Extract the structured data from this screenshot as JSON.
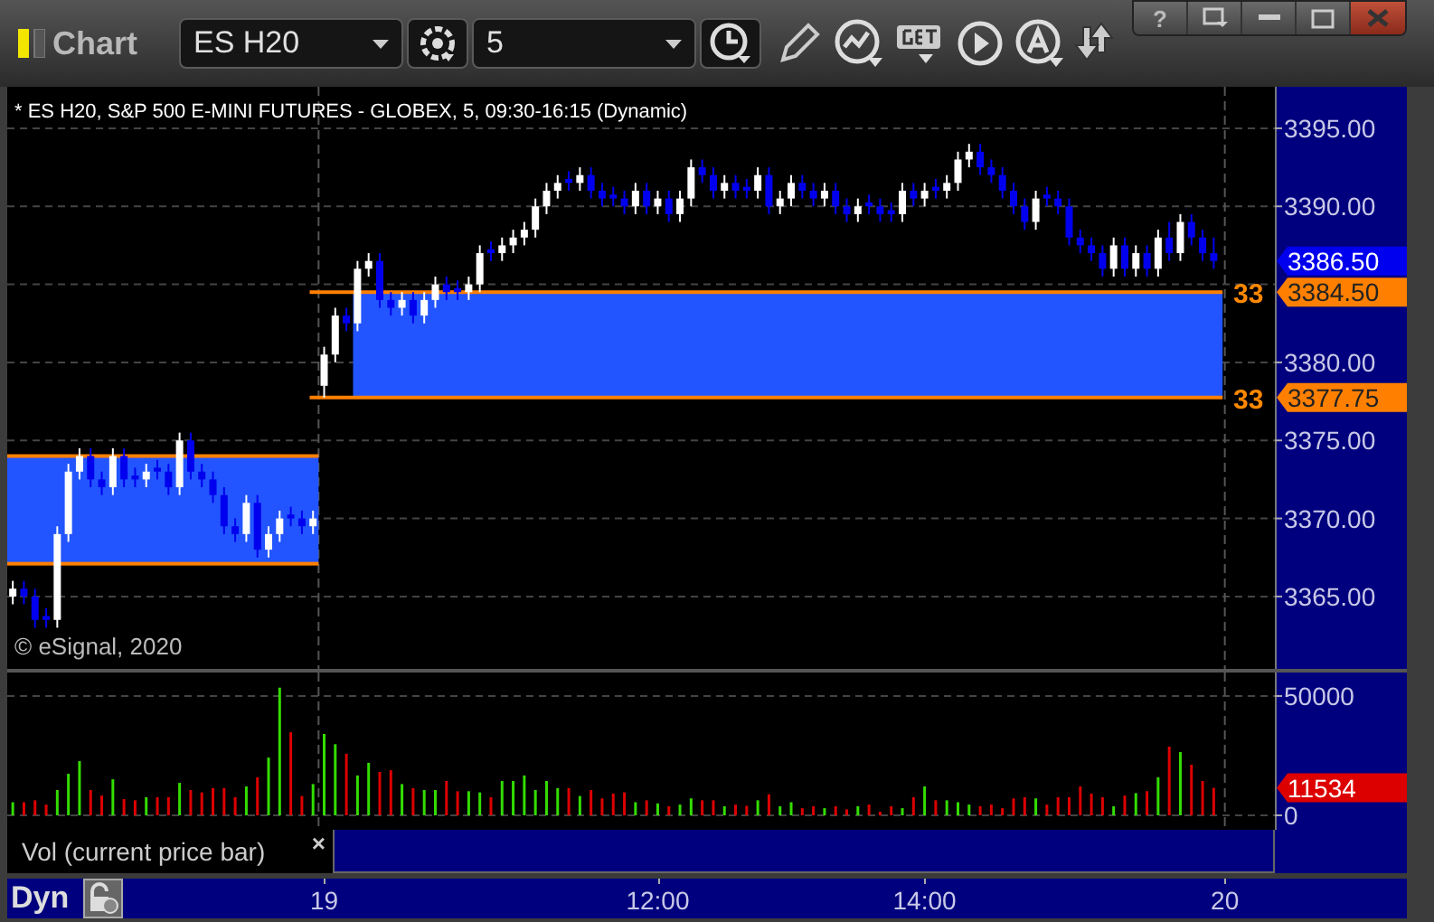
{
  "window": {
    "title": "Chart",
    "help_button": "?"
  },
  "toolbar": {
    "symbol": "ES H20",
    "interval": "5"
  },
  "chart_title": "* ES H20, S&P 500 E-MINI FUTURES - GLOBEX, 5, 09:30-16:15 (Dynamic)",
  "copyright": "© eSignal, 2020",
  "price_chart": {
    "chart_data": {
      "type": "candlestick",
      "grid": true,
      "categories": [
        null,
        null,
        null,
        null,
        null,
        null,
        null,
        null,
        null,
        null,
        null,
        null,
        null,
        null,
        null,
        null,
        null,
        null,
        null,
        null,
        null,
        null,
        null,
        null,
        null,
        null,
        null,
        null,
        null,
        null,
        null,
        null,
        null,
        null,
        null,
        null,
        null,
        null,
        null,
        null,
        null,
        null,
        null,
        null,
        null,
        null,
        null,
        null,
        null,
        null,
        null,
        null,
        null,
        null,
        null,
        null,
        null,
        null,
        null,
        null,
        null,
        null,
        null,
        null,
        null,
        null,
        null,
        null,
        null,
        null,
        null,
        null,
        null,
        null,
        null,
        null,
        null,
        null,
        null,
        null,
        null,
        null,
        null,
        null,
        null,
        null,
        null,
        null,
        null,
        null,
        null,
        null,
        null,
        null,
        null,
        null,
        null,
        null,
        null,
        null,
        null,
        null,
        null,
        null,
        null,
        null,
        null,
        null,
        null,
        null,
        null,
        null,
        null,
        null
      ],
      "ohlc": [
        [
          3365,
          3366,
          3364.5,
          3365.5
        ],
        [
          3365.5,
          3366,
          3364.5,
          3365
        ],
        [
          3365,
          3365.5,
          3363,
          3363.5
        ],
        [
          3363.75,
          3364.25,
          3363,
          3363.5
        ],
        [
          3363.5,
          3369.5,
          3363,
          3369
        ],
        [
          3369,
          3373.5,
          3368.5,
          3373
        ],
        [
          3373,
          3374.5,
          3372.5,
          3374
        ],
        [
          3374,
          3374.5,
          3372,
          3372.5
        ],
        [
          3372.5,
          3373,
          3371.5,
          3372
        ],
        [
          3372,
          3374.5,
          3371.5,
          3374
        ],
        [
          3374,
          3374.5,
          3372,
          3372.5
        ],
        [
          3372.75,
          3373.25,
          3372,
          3372.5
        ],
        [
          3372.5,
          3373.5,
          3372,
          3373
        ],
        [
          3373.25,
          3373.75,
          3372.5,
          3373
        ],
        [
          3373,
          3373.5,
          3371.5,
          3372
        ],
        [
          3372,
          3375.5,
          3371.5,
          3375
        ],
        [
          3375,
          3375.5,
          3372.5,
          3373
        ],
        [
          3373,
          3373.5,
          3372,
          3372.5
        ],
        [
          3372.5,
          3373,
          3371,
          3371.5
        ],
        [
          3371.5,
          3372,
          3369,
          3369.5
        ],
        [
          3369.5,
          3370,
          3368.5,
          3369
        ],
        [
          3369,
          3371.5,
          3368.5,
          3371
        ],
        [
          3371,
          3371.5,
          3367.5,
          3368
        ],
        [
          3368,
          3369.5,
          3367.5,
          3369
        ],
        [
          3369,
          3370.5,
          3368.5,
          3370
        ],
        [
          3370.25,
          3370.75,
          3369.5,
          3370
        ],
        [
          3370,
          3370.5,
          3369,
          3369.5
        ],
        [
          3369.5,
          3370.5,
          3369,
          3370
        ],
        [
          3378.5,
          3381,
          3377.75,
          3380.5
        ],
        [
          3380.5,
          3383.5,
          3380,
          3383
        ],
        [
          3383,
          3383.5,
          3382,
          3382.5
        ],
        [
          3382.5,
          3386.5,
          3382,
          3386
        ],
        [
          3386,
          3387,
          3385.5,
          3386.5
        ],
        [
          3386.5,
          3387,
          3383.5,
          3384
        ],
        [
          3384,
          3384.5,
          3383,
          3383.5
        ],
        [
          3383.5,
          3384.5,
          3383,
          3384
        ],
        [
          3384,
          3384.5,
          3382.5,
          3383
        ],
        [
          3383,
          3384.5,
          3382.5,
          3384
        ],
        [
          3384,
          3385.5,
          3383.5,
          3385
        ],
        [
          3385,
          3385.5,
          3384,
          3384.5
        ],
        [
          3384.75,
          3385.25,
          3384,
          3384.5
        ],
        [
          3384.5,
          3385.5,
          3384,
          3385
        ],
        [
          3385,
          3387.5,
          3384.5,
          3387
        ],
        [
          3387.25,
          3387.75,
          3386.5,
          3387
        ],
        [
          3387,
          3388,
          3386.5,
          3387.5
        ],
        [
          3387.5,
          3388.5,
          3387,
          3388
        ],
        [
          3388,
          3389,
          3387.5,
          3388.5
        ],
        [
          3388.5,
          3390.5,
          3388,
          3390
        ],
        [
          3390,
          3391.5,
          3389.5,
          3391
        ],
        [
          3391,
          3392,
          3390.5,
          3391.5
        ],
        [
          3391.75,
          3392.25,
          3391,
          3391.5
        ],
        [
          3391.5,
          3392.5,
          3391,
          3392
        ],
        [
          3392,
          3392.5,
          3390.5,
          3391
        ],
        [
          3391,
          3391.5,
          3390,
          3390.5
        ],
        [
          3390.75,
          3391.25,
          3390,
          3390.5
        ],
        [
          3390.5,
          3391,
          3389.5,
          3390
        ],
        [
          3390,
          3391.5,
          3389.5,
          3391
        ],
        [
          3391,
          3391.5,
          3389.5,
          3390
        ],
        [
          3390,
          3391,
          3389.5,
          3390.5
        ],
        [
          3390.5,
          3391,
          3389,
          3389.5
        ],
        [
          3389.5,
          3391,
          3389,
          3390.5
        ],
        [
          3390.5,
          3393,
          3390,
          3392.5
        ],
        [
          3392.5,
          3393,
          3391.5,
          3392
        ],
        [
          3392,
          3392.5,
          3390.5,
          3391
        ],
        [
          3391,
          3392,
          3390.5,
          3391.5
        ],
        [
          3391.5,
          3392,
          3390.5,
          3391
        ],
        [
          3391.25,
          3391.75,
          3390.5,
          3391
        ],
        [
          3391,
          3392.5,
          3390.5,
          3392
        ],
        [
          3392,
          3392.5,
          3389.5,
          3390
        ],
        [
          3390,
          3391,
          3389.5,
          3390.5
        ],
        [
          3390.5,
          3392,
          3390,
          3391.5
        ],
        [
          3391.5,
          3392,
          3390.5,
          3391
        ],
        [
          3391,
          3391.5,
          3390,
          3390.5
        ],
        [
          3390.5,
          3391.5,
          3390,
          3391
        ],
        [
          3391,
          3391.5,
          3389.5,
          3390
        ],
        [
          3390,
          3390.5,
          3389,
          3389.5
        ],
        [
          3389.5,
          3390.5,
          3389,
          3390
        ],
        [
          3390.25,
          3390.75,
          3389.5,
          3390
        ],
        [
          3390,
          3390.5,
          3389,
          3389.5
        ],
        [
          3389.75,
          3390.25,
          3389,
          3389.5
        ],
        [
          3389.5,
          3391.5,
          3389,
          3391
        ],
        [
          3391,
          3391.5,
          3390,
          3390.5
        ],
        [
          3390.5,
          3391.5,
          3390,
          3391
        ],
        [
          3391.25,
          3391.75,
          3390.5,
          3391
        ],
        [
          3391,
          3392,
          3390.5,
          3391.5
        ],
        [
          3391.5,
          3393.5,
          3391,
          3393
        ],
        [
          3393,
          3394,
          3392.5,
          3393.5
        ],
        [
          3393.5,
          3394,
          3392,
          3392.5
        ],
        [
          3392.5,
          3393,
          3391.5,
          3392
        ],
        [
          3392,
          3392.5,
          3390.5,
          3391
        ],
        [
          3391,
          3391.5,
          3389.5,
          3390
        ],
        [
          3390,
          3390.5,
          3388.5,
          3389
        ],
        [
          3389,
          3391,
          3388.5,
          3390.5
        ],
        [
          3390.75,
          3391.25,
          3390,
          3390.5
        ],
        [
          3390.5,
          3391,
          3389.5,
          3390
        ],
        [
          3390,
          3390.5,
          3387.5,
          3388
        ],
        [
          3388,
          3388.5,
          3387,
          3387.5
        ],
        [
          3387.5,
          3388,
          3386.5,
          3387
        ],
        [
          3387,
          3387.5,
          3385.5,
          3386
        ],
        [
          3386,
          3388,
          3385.5,
          3387.5
        ],
        [
          3387.5,
          3388,
          3385.5,
          3386
        ],
        [
          3386,
          3387.5,
          3385.5,
          3387
        ],
        [
          3387,
          3387.5,
          3385.5,
          3386
        ],
        [
          3386,
          3388.5,
          3385.5,
          3388
        ],
        [
          3388,
          3389,
          3386.5,
          3387
        ],
        [
          3387,
          3389.5,
          3386.5,
          3389
        ],
        [
          3389,
          3389.5,
          3387.5,
          3388
        ],
        [
          3388,
          3388.5,
          3386.5,
          3387
        ],
        [
          3387,
          3388,
          3386,
          3386.5
        ],
        null,
        null,
        null,
        null,
        null
      ],
      "ylim": [
        3360.36,
        3397.66
      ],
      "yticks": [
        {
          "value": 3365,
          "label": "3365.00"
        },
        {
          "value": 3370,
          "label": "3370.00"
        },
        {
          "value": 3375,
          "label": "3375.00"
        },
        {
          "value": 3380,
          "label": "3380.00"
        },
        {
          "value": 3390,
          "label": "3390.00"
        },
        {
          "value": 3395,
          "label": "3395.00"
        }
      ],
      "bands": [
        {
          "axis": "y",
          "from": 3367.1,
          "to": 3374
        },
        {
          "axis": "y",
          "from": 3377.75,
          "to": 3384.5
        }
      ],
      "ref_lines": [
        {
          "axis": "y",
          "value": 3384.5,
          "label": "3384.50",
          "color": "#ff8000"
        },
        {
          "axis": "y",
          "value": 3377.75,
          "label": "3377.75",
          "color": "#ff8000"
        }
      ]
    },
    "level_labels": [
      "33",
      "33"
    ],
    "last_price_label": "3386.50"
  },
  "volume_chart": {
    "close_button": "×",
    "last_value_label": "11534",
    "chart_data": {
      "type": "bar",
      "grid": true,
      "title": "Vol (current price bar)",
      "categories": [
        null,
        null,
        null,
        null,
        null,
        null,
        null,
        null,
        null,
        null,
        null,
        null,
        null,
        null,
        null,
        null,
        null,
        null,
        null,
        null,
        null,
        null,
        null,
        null,
        null,
        null,
        null,
        null,
        "19",
        null,
        null,
        null,
        null,
        null,
        null,
        null,
        null,
        null,
        null,
        null,
        null,
        null,
        null,
        null,
        null,
        null,
        null,
        null,
        null,
        null,
        null,
        null,
        null,
        null,
        null,
        null,
        null,
        null,
        "12:00",
        null,
        null,
        null,
        null,
        null,
        null,
        null,
        null,
        null,
        null,
        null,
        null,
        null,
        null,
        null,
        null,
        null,
        null,
        null,
        null,
        null,
        null,
        null,
        "14:00",
        null,
        null,
        null,
        null,
        null,
        null,
        null,
        null,
        null,
        null,
        null,
        null,
        null,
        null,
        null,
        null,
        null,
        null,
        null,
        null,
        null,
        null,
        null,
        null,
        null,
        null,
        "20",
        null,
        null,
        null,
        null
      ],
      "values": [
        5500,
        5500,
        6300,
        4500,
        10600,
        17400,
        22700,
        10600,
        8300,
        15100,
        6800,
        6300,
        7600,
        7600,
        7600,
        13600,
        10600,
        9600,
        11400,
        11400,
        7600,
        12100,
        15900,
        24200,
        53500,
        34800,
        8100,
        13100,
        34100,
        29800,
        25800,
        16700,
        22000,
        18200,
        18900,
        13100,
        11400,
        10600,
        10600,
        14400,
        10100,
        10100,
        9600,
        7600,
        14400,
        14400,
        16700,
        10600,
        14400,
        11400,
        11400,
        8100,
        10600,
        7100,
        9100,
        9600,
        5500,
        6300,
        5000,
        3800,
        4500,
        7100,
        6300,
        6300,
        3800,
        4500,
        4000,
        6300,
        8800,
        3800,
        5500,
        3000,
        3800,
        3000,
        3800,
        2500,
        3800,
        4500,
        1500,
        3800,
        3000,
        7600,
        12100,
        6300,
        6300,
        5500,
        4500,
        3800,
        4500,
        3000,
        7100,
        7600,
        7100,
        4500,
        7600,
        7600,
        12100,
        9100,
        7600,
        3800,
        8300,
        9300,
        10100,
        15900,
        28800,
        26500,
        21200,
        14400,
        11534,
        null,
        null,
        null,
        null,
        null
      ],
      "ylim": [
        -6061,
        59848
      ],
      "yticks": [
        {
          "value": 0,
          "label": "0"
        },
        {
          "value": 50000,
          "label": "50000"
        }
      ]
    }
  },
  "bottom_bar": {
    "mode": "Dyn"
  }
}
